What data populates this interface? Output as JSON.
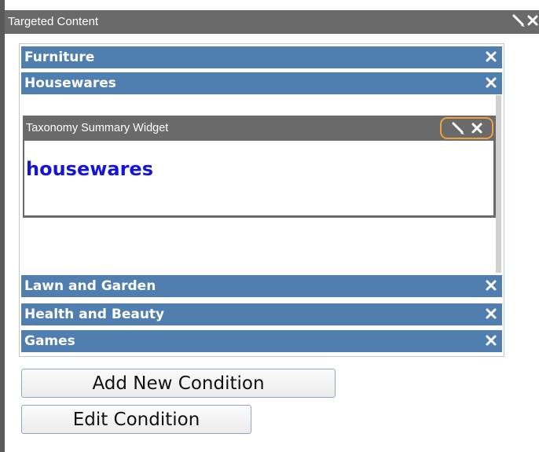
{
  "window": {
    "title": "Targeted Content"
  },
  "categories": [
    {
      "label": "Furniture"
    },
    {
      "label": "Housewares"
    },
    {
      "label": "Lawn and Garden"
    },
    {
      "label": "Health and Beauty"
    },
    {
      "label": "Games"
    }
  ],
  "widget": {
    "title": "Taxonomy Summary Widget",
    "content": "housewares"
  },
  "buttons": {
    "add_condition": "Add New Condition",
    "edit_condition": "Edit Condition"
  },
  "colors": {
    "category_bar": "#4f7eaf",
    "header_gray": "#6a6a6a",
    "link_blue": "#1515d6",
    "highlight_orange": "#f0a040"
  },
  "icons": [
    "pencil-icon",
    "close-icon"
  ]
}
